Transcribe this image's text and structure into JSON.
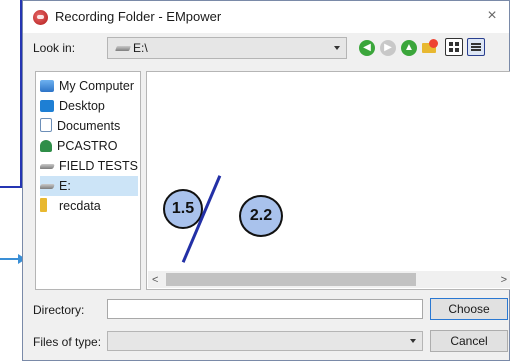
{
  "window": {
    "title": "Recording Folder - EMpower",
    "close_label": "×"
  },
  "look_in": {
    "label": "Look in:",
    "value": "E:\\"
  },
  "toolbar": {
    "back_glyph": "◀",
    "forward_glyph": "▶",
    "up_glyph": "▲"
  },
  "sidebar": {
    "items": [
      {
        "label": "My Computer",
        "icon": "computer-icon"
      },
      {
        "label": "Desktop",
        "icon": "desktop-icon"
      },
      {
        "label": "Documents",
        "icon": "documents-icon"
      },
      {
        "label": "PCASTRO",
        "icon": "user-icon"
      },
      {
        "label": "FIELD TESTS...",
        "icon": "drive-icon"
      },
      {
        "label": "E:",
        "icon": "drive-icon",
        "selected": true
      },
      {
        "label": "recdata",
        "icon": "folder-icon"
      }
    ]
  },
  "scrollbar": {
    "left_arrow": "<",
    "right_arrow": ">"
  },
  "annotations": {
    "badge_left": "1.5",
    "badge_right": "2.2"
  },
  "directory": {
    "label": "Directory:",
    "value": ""
  },
  "files_of_type": {
    "label": "Files of type:",
    "value": ""
  },
  "buttons": {
    "choose": "Choose",
    "cancel": "Cancel"
  },
  "colors": {
    "accent": "#2a78d2",
    "selection": "#cce4f7",
    "badge_fill": "#a9c2ec",
    "annotation_line": "#2330a6"
  }
}
